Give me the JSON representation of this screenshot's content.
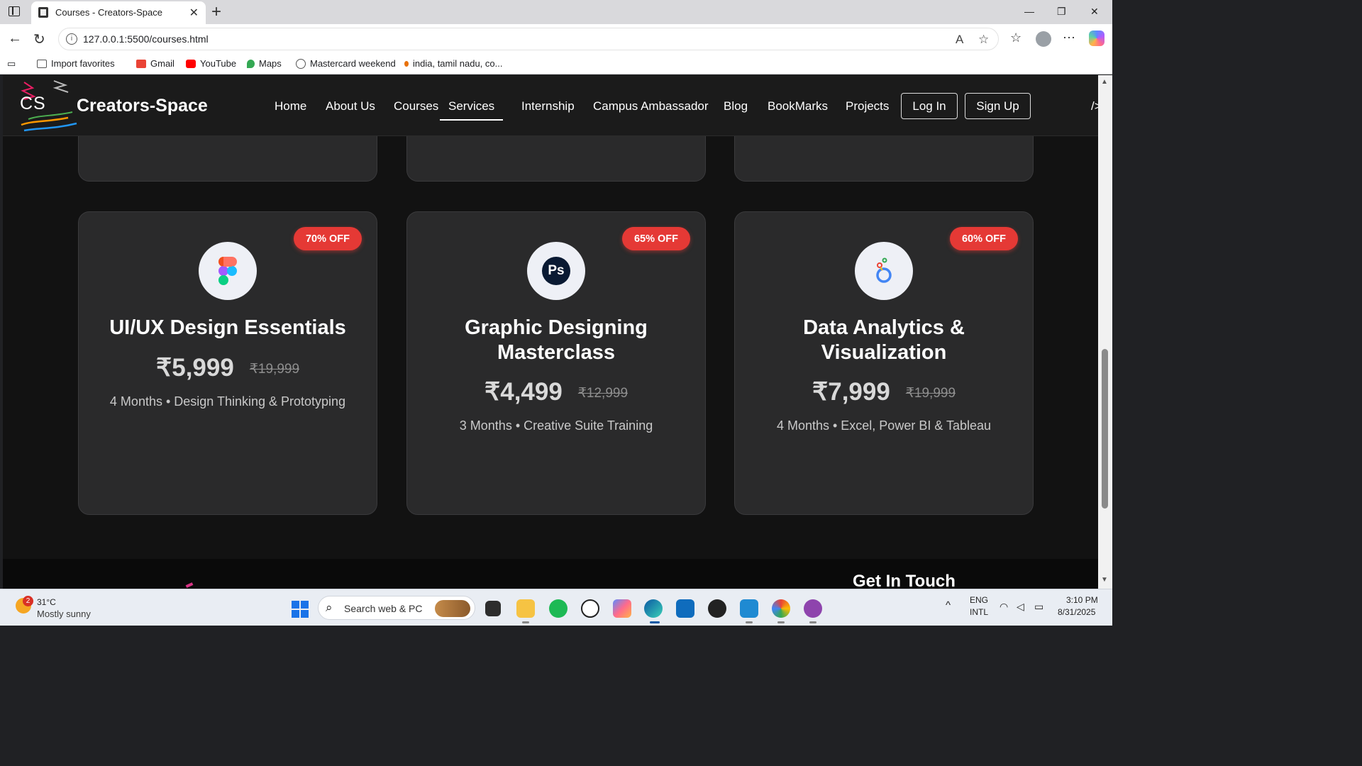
{
  "browser": {
    "tab_title": "Courses - Creators-Space",
    "url": "127.0.0.1:5500/courses.html",
    "favorites": [
      {
        "label": "Import favorites",
        "icon": "import-icon",
        "color": "#555555"
      },
      {
        "label": "Gmail",
        "icon": "gmail-icon",
        "color": "#ea4335"
      },
      {
        "label": "YouTube",
        "icon": "youtube-icon",
        "color": "#ff0000"
      },
      {
        "label": "Maps",
        "icon": "maps-icon",
        "color": "#34a853"
      },
      {
        "label": "Mastercard weekend",
        "icon": "globe-icon",
        "color": "#555555"
      },
      {
        "label": "india, tamil nadu, co...",
        "icon": "pin-icon",
        "color": "#e8710a"
      }
    ]
  },
  "site": {
    "logo_text": "CS",
    "brand": "Creators-Space",
    "nav": [
      "Home",
      "About Us",
      "Courses",
      "Services",
      "Internship",
      "Campus Ambassador",
      "Blog",
      "BookMarks",
      "Projects"
    ],
    "active_nav": "Services",
    "login": "Log In",
    "signup": "Sign Up",
    "cut_text": "/>"
  },
  "courses": [
    {
      "badge": "70% OFF",
      "title": "UI/UX Design Essentials",
      "price": "₹5,999",
      "old_price": "₹19,999",
      "meta": "4 Months • Design Thinking & Prototyping",
      "icon": "figma-icon"
    },
    {
      "badge": "65% OFF",
      "title": "Graphic Designing Masterclass",
      "price": "₹4,499",
      "old_price": "₹12,999",
      "meta": "3 Months • Creative Suite Training",
      "icon": "photoshop-icon"
    },
    {
      "badge": "60% OFF",
      "title": "Data Analytics & Visualization",
      "price": "₹7,999",
      "old_price": "₹19,999",
      "meta": "4 Months • Excel, Power BI & Tableau",
      "icon": "analytics-icon"
    }
  ],
  "footer": {
    "get_in_touch": "Get In Touch"
  },
  "taskbar": {
    "weather_temp": "31°C",
    "weather_desc": "Mostly sunny",
    "weather_badge": "2",
    "search_placeholder": "Search web & PC",
    "lang1": "ENG",
    "lang2": "INTL",
    "time": "3:10 PM",
    "date": "8/31/2025"
  }
}
